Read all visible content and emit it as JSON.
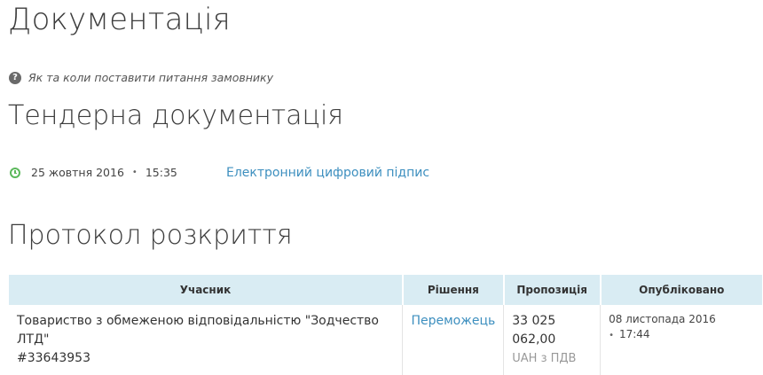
{
  "page_title": "Документація",
  "help_link": {
    "icon": "question-circle-icon",
    "text": "Як та коли поставити питання замовнику"
  },
  "tender_docs": {
    "heading": "Тендерна документація",
    "date": "25 жовтня 2016",
    "time": "15:35",
    "signature_link": "Електронний цифровий підпис",
    "icon_color": "#5cb85c"
  },
  "protocol": {
    "heading": "Протокол розкриття",
    "columns": [
      "Учасник",
      "Рішення",
      "Пропозиція",
      "Опубліковано"
    ],
    "rows": [
      {
        "participant_name": "Товариство з обмеженою відповідальністю \"Зодчество ЛТД\"",
        "participant_code": "#33643953",
        "decision": "Переможець",
        "offer_amount": "33 025 062,00",
        "offer_currency": "UAH з ПДВ",
        "published_date": "08 листопада 2016",
        "published_time": "17:44"
      }
    ],
    "header_bg": "#d9ecf3",
    "link_color": "#3d8fbf"
  }
}
